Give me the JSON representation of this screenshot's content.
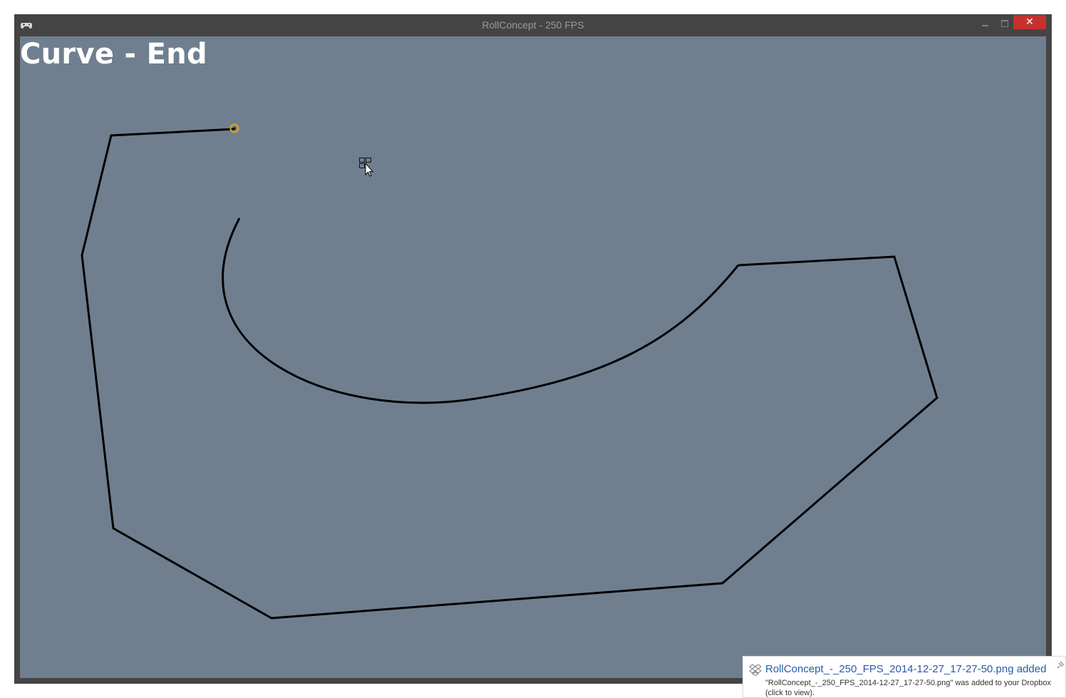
{
  "window": {
    "title": "RollConcept - 250 FPS",
    "close_glyph": "✕",
    "icons": [
      "gamepad-icon",
      "minimize-icon",
      "maximize-icon",
      "close-icon"
    ]
  },
  "scene": {
    "title": "Curve - End",
    "background_color": "#6f7f90",
    "path_color": "#000000",
    "endpoint_marker_color": "#e8a020"
  },
  "notification": {
    "title": "RollConcept_-_250_FPS_2014-12-27_17-27-50.png added",
    "body_line1": "\"RollConcept_-_250_FPS_2014-12-27_17-27-50.png\" was added to your Dropbox",
    "body_line2": "(click to view).",
    "icons": [
      "dropbox-icon",
      "pin-icon"
    ]
  }
}
